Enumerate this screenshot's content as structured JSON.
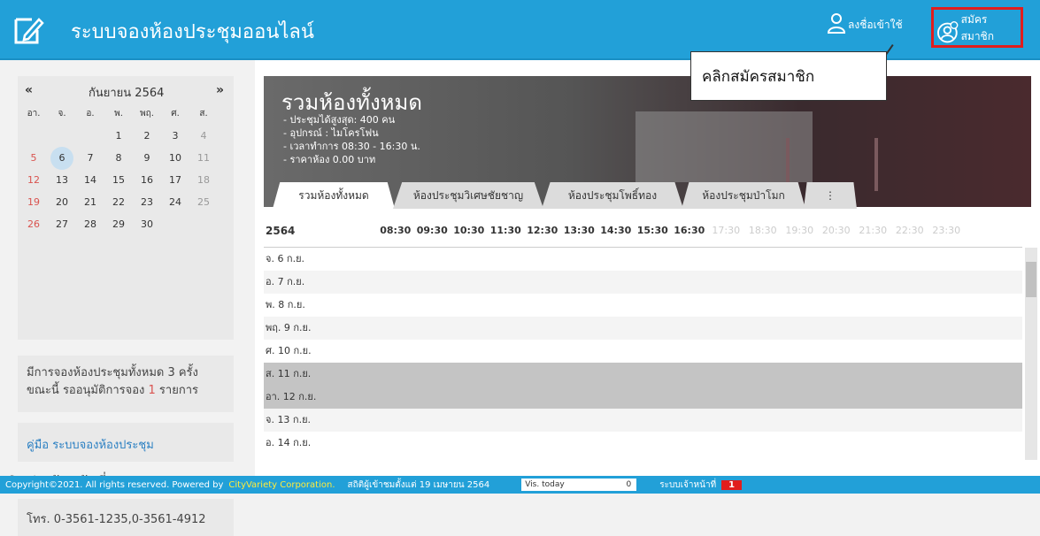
{
  "header": {
    "app_title": "ระบบจองห้องประชุมออนไลน์",
    "login_label": "ลงชื่อเข้าใช้",
    "register_label": "สมัครสมาชิก",
    "callout_text": "คลิกสมัครสมาชิก",
    "brand_color": "#22a0d8"
  },
  "calendar": {
    "prev": "«",
    "next": "»",
    "month": "กันยายน 2564",
    "weekdays": [
      "อา.",
      "จ.",
      "อ.",
      "พ.",
      "พฤ.",
      "ศ.",
      "ส."
    ],
    "weeks": [
      [
        "",
        "",
        "",
        "1",
        "2",
        "3",
        "4"
      ],
      [
        "5",
        "6",
        "7",
        "8",
        "9",
        "10",
        "11"
      ],
      [
        "12",
        "13",
        "14",
        "15",
        "16",
        "17",
        "18"
      ],
      [
        "19",
        "20",
        "21",
        "22",
        "23",
        "24",
        "25"
      ],
      [
        "26",
        "27",
        "28",
        "29",
        "30",
        "",
        ""
      ]
    ],
    "today": "6"
  },
  "sidebar": {
    "info_line1_prefix": "มีการจองห้องประชุมทั้งหมด 3 ครั้ง",
    "info_line2_prefix": "ขณะนี้ รออนุมัติการจอง ",
    "info_pending": "1",
    "info_line2_suffix": " รายการ",
    "manual_link": "คู่มือ ระบบจองห้องประชุม",
    "contact_title": "ติดต่อเจ้าหน้าที่",
    "contact_phone": "โทร. 0-3561-1235,0-3561-4912"
  },
  "room": {
    "title": "รวมห้องทั้งหมด",
    "info": [
      "- ประชุมได้สูงสุด: 400 คน",
      "- อุปกรณ์ : ไมโครโฟน",
      "- เวลาทำการ 08:30 - 16:30 น.",
      "- ราคาห้อง 0.00 บาท"
    ]
  },
  "tabs": [
    "รวมห้องทั้งหมด",
    "ห้องประชุมวิเศษชัยชาญ",
    "ห้องประชุมโพธิ์ทอง",
    "ห้องประชุมป่าโมก",
    "⋮"
  ],
  "timeline": {
    "year": "2564",
    "times_active": [
      "08:30",
      "09:30",
      "10:30",
      "11:30",
      "12:30",
      "13:30",
      "14:30",
      "15:30",
      "16:30"
    ],
    "times_inactive": [
      "17:30",
      "18:30",
      "19:30",
      "20:30",
      "21:30",
      "22:30",
      "23:30"
    ],
    "dates": [
      "จ. 6 ก.ย.",
      "อ. 7 ก.ย.",
      "พ. 8 ก.ย.",
      "พฤ. 9 ก.ย.",
      "ศ. 10 ก.ย.",
      "ส. 11 ก.ย.",
      "อา. 12 ก.ย.",
      "จ. 13 ก.ย.",
      "อ. 14 ก.ย."
    ]
  },
  "footer": {
    "copyright": "Copyright©2021. All rights reserved. Powered by",
    "company": "CityVariety Corporation.",
    "stats": "สถิติผู้เข้าชมตั้งแต่ 19 เมษายน 2564",
    "vis_label": "Vis. today",
    "vis_value": "0",
    "staff_label": "ระบบเจ้าหน้าที่",
    "staff_count": "1"
  }
}
